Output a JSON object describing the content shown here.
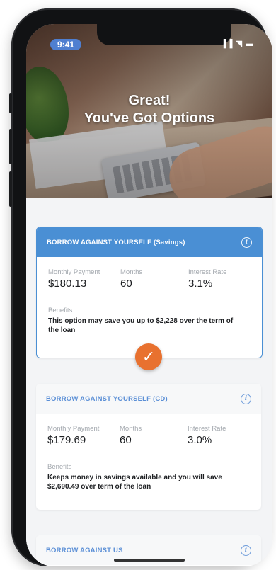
{
  "status_bar": {
    "time": "9:41",
    "icons": "▐▐ ◥ ▬"
  },
  "hero": {
    "title_line1": "Great!",
    "title_line2": "You've Got Options"
  },
  "cards": [
    {
      "title": "BORROW AGAINST YOURSELF (Savings)",
      "selected": true,
      "monthly_payment_label": "Monthly Payment",
      "monthly_payment": "$180.13",
      "months_label": "Months",
      "months": "60",
      "interest_label": "Interest Rate",
      "interest": "3.1%",
      "benefits_label": "Benefits",
      "benefits": "This option may save you up to $2,228 over the term of the loan"
    },
    {
      "title": "BORROW AGAINST YOURSELF (CD)",
      "selected": false,
      "monthly_payment_label": "Monthly Payment",
      "monthly_payment": "$179.69",
      "months_label": "Months",
      "months": "60",
      "interest_label": "Interest Rate",
      "interest": "3.0%",
      "benefits_label": "Benefits",
      "benefits": "Keeps money in savings available and you will save $2,690.49 over term of the loan"
    },
    {
      "title": "BORROW AGAINST US",
      "selected": false
    }
  ],
  "icons": {
    "info": "info-icon",
    "check": "checkmark-icon"
  },
  "colors": {
    "accent": "#4a8fd4",
    "check": "#e8712f"
  }
}
